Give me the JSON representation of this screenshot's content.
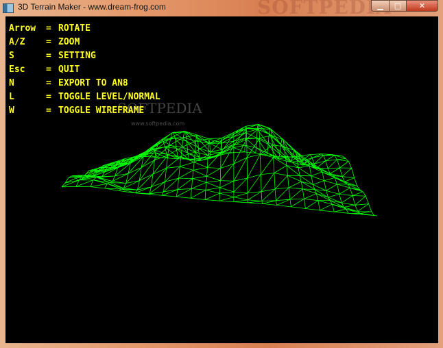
{
  "window": {
    "title": "3D Terrain Maker - www.dream-frog.com",
    "icon": "app-window-icon",
    "controls": {
      "minimize": "minimize-icon",
      "maximize": "maximize-icon",
      "close": "close-icon"
    }
  },
  "help": [
    {
      "key": "Arrow",
      "eq": "=",
      "action": "ROTATE"
    },
    {
      "key": "A/Z",
      "eq": "=",
      "action": "ZOOM"
    },
    {
      "key": "S",
      "eq": "=",
      "action": "SETTING"
    },
    {
      "key": "Esc",
      "eq": "=",
      "action": "QUIT"
    },
    {
      "key": "N",
      "eq": "=",
      "action": "EXPORT TO AN8"
    },
    {
      "key": "L",
      "eq": "=",
      "action": "TOGGLE LEVEL/NORMAL"
    },
    {
      "key": "W",
      "eq": "=",
      "action": "TOGGLE WIREFRAME"
    }
  ],
  "watermark": {
    "text": "SOFTPEDIA",
    "url": "www.softpedia.com"
  },
  "colors": {
    "background": "#000000",
    "help_text": "#ffff20",
    "wireframe": "#00ff00"
  }
}
